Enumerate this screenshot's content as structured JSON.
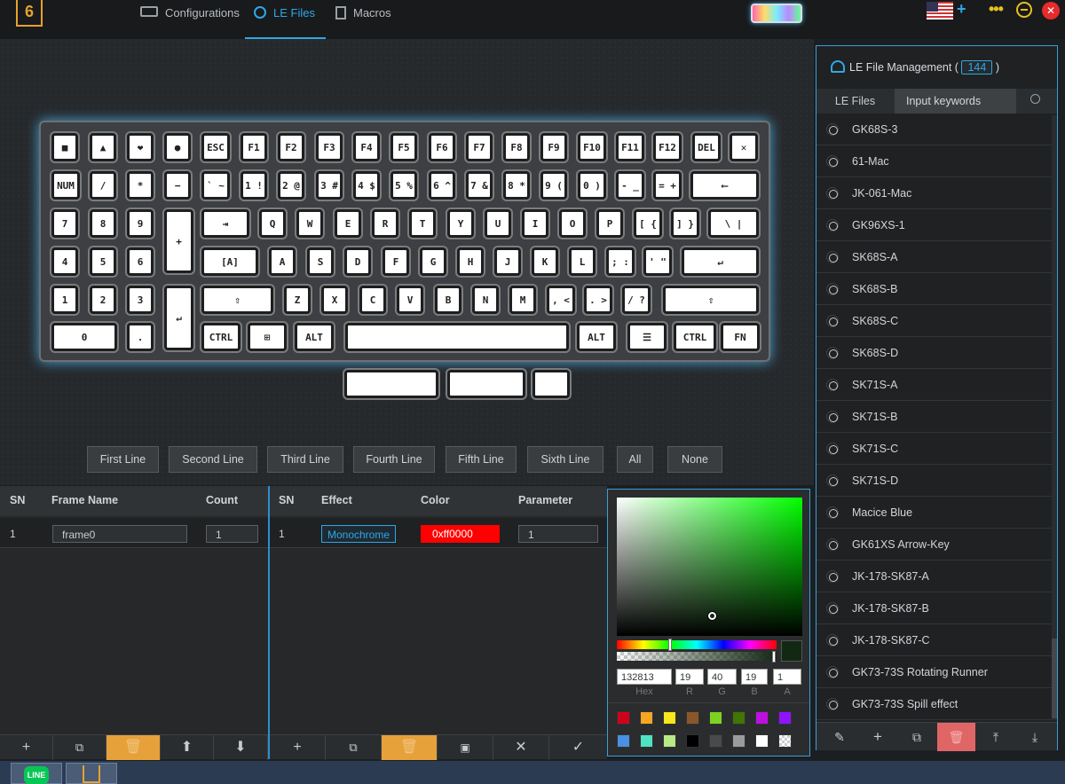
{
  "header": {
    "logo": "6",
    "tabs": [
      {
        "label": "Configurations",
        "active": false
      },
      {
        "label": "LE Files",
        "active": true
      },
      {
        "label": "Macros",
        "active": false
      }
    ]
  },
  "keyboard": {
    "rows": [
      [
        "■",
        "▲",
        "❤",
        "●",
        "ESC",
        "F1",
        "F2",
        "F3",
        "F4",
        "F5",
        "F6",
        "F7",
        "F8",
        "F9",
        "F10",
        "F11",
        "F12",
        "DEL",
        "✕"
      ],
      [
        "NUM",
        "/",
        "*",
        "−",
        "` ~",
        "1 !",
        "2 @",
        "3 #",
        "4 $",
        "5 %",
        "6 ^",
        "7 &",
        "8 *",
        "9 (",
        "0 )",
        "- _",
        "= +",
        "⟵"
      ],
      [
        "7",
        "8",
        "9",
        "+",
        "⇥",
        "Q",
        "W",
        "E",
        "R",
        "T",
        "Y",
        "U",
        "I",
        "O",
        "P",
        "[ {",
        "] }",
        "\\ |"
      ],
      [
        "4",
        "5",
        "6",
        "[A]",
        "A",
        "S",
        "D",
        "F",
        "G",
        "H",
        "J",
        "K",
        "L",
        "; :",
        "' \"",
        "↵"
      ],
      [
        "1",
        "2",
        "3",
        "↵",
        "⇧",
        "Z",
        "X",
        "C",
        "V",
        "B",
        "N",
        "M",
        ", <",
        ". >",
        "/ ?",
        "⇧"
      ],
      [
        "0",
        ".",
        "CTRL",
        "⊞",
        "ALT",
        "",
        "ALT",
        "☰",
        "CTRL",
        "FN"
      ]
    ],
    "extra_keys": [
      "",
      "",
      ""
    ]
  },
  "line_buttons": [
    "First Line",
    "Second Line",
    "Third Line",
    "Fourth Line",
    "Fifth Line",
    "Sixth Line",
    "All",
    "None"
  ],
  "frames": {
    "headers": [
      "SN",
      "Frame Name",
      "Count"
    ],
    "rows": [
      {
        "sn": "1",
        "name": "frame0",
        "count": "1"
      }
    ]
  },
  "effects": {
    "headers": [
      "SN",
      "Effect",
      "Color",
      "Parameter"
    ],
    "rows": [
      {
        "sn": "1",
        "effect": "Monochrome",
        "color": "0xff0000",
        "parameter": "1"
      }
    ]
  },
  "picker": {
    "hex": "132813",
    "r": "19",
    "g": "40",
    "b": "19",
    "a": "1",
    "labels": [
      "Hex",
      "R",
      "G",
      "B",
      "A"
    ],
    "swatches": [
      "#d0021b",
      "#f5a623",
      "#f8e71c",
      "#8b572a",
      "#7ed321",
      "#417505",
      "#bd10e0",
      "#9013fe",
      "#4a90e2",
      "#50e3c2",
      "#b8e986",
      "#000000",
      "#4a4a4a",
      "#9b9b9b",
      "#ffffff",
      "checker"
    ]
  },
  "sidebar": {
    "title": "LE File Management (",
    "count": "144",
    "title_end": ")",
    "tab": "LE Files",
    "search_placeholder": "Input keywords",
    "items": [
      "GK68S-3",
      "61-Mac",
      "JK-061-Mac",
      "GK96XS-1",
      "SK68S-A",
      "SK68S-B",
      "SK68S-C",
      "SK68S-D",
      "SK71S-A",
      "SK71S-B",
      "SK71S-C",
      "SK71S-D",
      "Macice Blue",
      "GK61XS Arrow-Key",
      "JK-178-SK87-A",
      "JK-178-SK87-B",
      "JK-178-SK87-C",
      "GK73-73S Rotating Runner",
      "GK73-73S Spill effect"
    ]
  },
  "taskbar": {
    "line_label": "LINE"
  }
}
